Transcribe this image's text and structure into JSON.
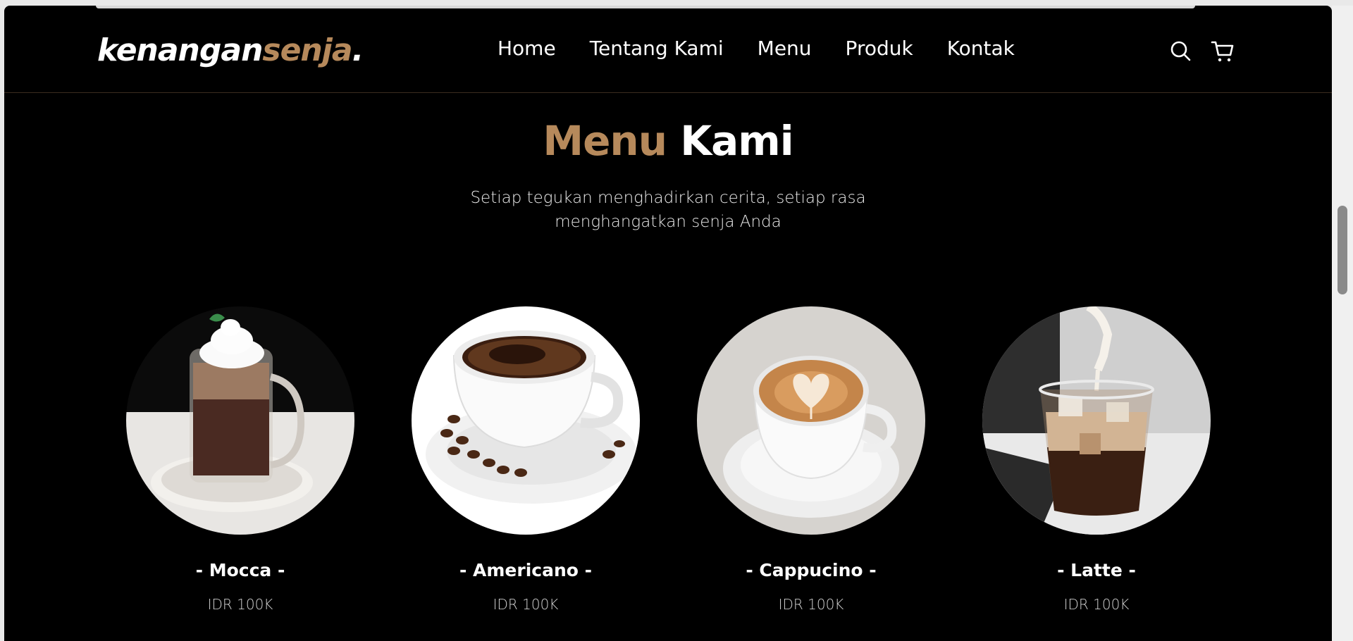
{
  "brand": {
    "name_part1": "kenangan",
    "name_part2": "senja",
    "name_part3": "."
  },
  "nav": {
    "links": [
      "Home",
      "Tentang Kami",
      "Menu",
      "Produk",
      "Kontak"
    ],
    "icons": [
      "search-icon",
      "cart-icon"
    ]
  },
  "section": {
    "title_accent": "Menu",
    "title_rest": " Kami",
    "subtitle_line1": "Setiap tegukan menghadirkan cerita, setiap rasa",
    "subtitle_line2": "menghangatkan senja Anda"
  },
  "menu": [
    {
      "name": "- Mocca -",
      "price": "IDR 100K"
    },
    {
      "name": "- Americano -",
      "price": "IDR 100K"
    },
    {
      "name": "- Cappucino -",
      "price": "IDR 100K"
    },
    {
      "name": "- Latte -",
      "price": "IDR 100K"
    }
  ],
  "colors": {
    "accent": "#b6895b",
    "background": "#000000",
    "text": "#ffffff"
  }
}
